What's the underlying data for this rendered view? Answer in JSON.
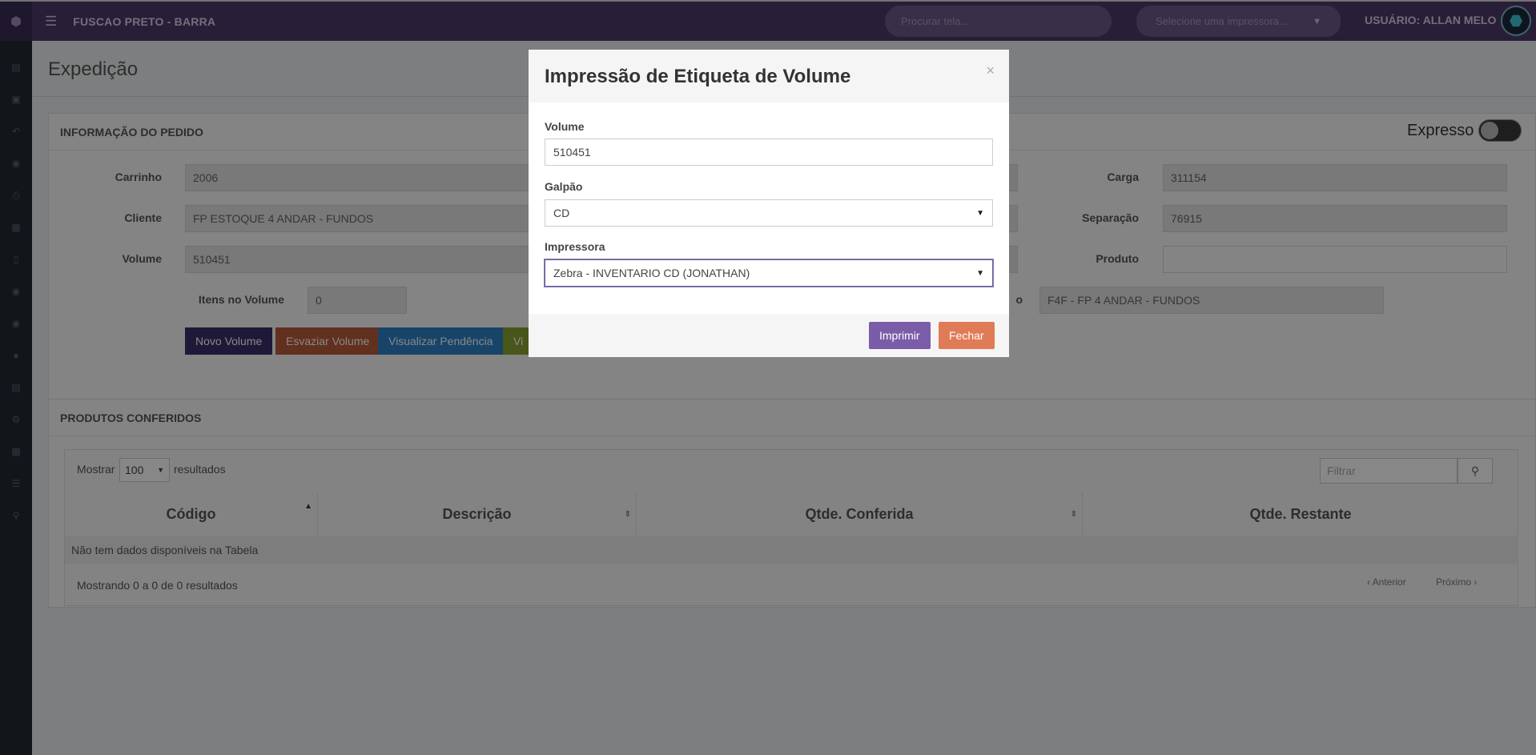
{
  "topbar": {
    "app_title": "FUSCAO PRETO - BARRA",
    "search_placeholder": "Procurar tela...",
    "printer_placeholder": "Selecione uma impressora...",
    "user_label": "USUÁRIO: ALLAN MELO"
  },
  "page": {
    "title": "Expedição"
  },
  "pedido": {
    "header": "INFORMAÇÃO DO PEDIDO",
    "expresso_label": "Expresso",
    "carrinho_label": "Carrinho",
    "carrinho_value": "2006",
    "cliente_label": "Cliente",
    "cliente_value": "FP ESTOQUE 4 ANDAR - FUNDOS",
    "volume_label": "Volume",
    "volume_value": "510451",
    "itens_label": "Itens no Volume",
    "itens_value": "0",
    "carga_label": "Carga",
    "carga_value": "311154",
    "separacao_label": "Separação",
    "separacao_value": "76915",
    "produto_label": "Produto",
    "produto_value": "",
    "partial_label": "o",
    "partial_value": "F4F - FP 4 ANDAR - FUNDOS",
    "btn_novo": "Novo Volume",
    "btn_esvaziar": "Esvaziar Volume",
    "btn_visualizar": "Visualizar Pendência",
    "btn_partial": "Vi"
  },
  "produtos": {
    "header": "PRODUTOS CONFERIDOS",
    "mostrar_label": "Mostrar",
    "mostrar_value": "100",
    "resultados_label": "resultados",
    "filter_placeholder": "Filtrar",
    "columns": [
      "Código",
      "Descrição",
      "Qtde. Conferida",
      "Qtde. Restante"
    ],
    "empty_message": "Não tem dados disponíveis na Tabela",
    "info": "Mostrando 0 a 0 de 0 resultados",
    "prev_label": "Anterior",
    "next_label": "Próximo"
  },
  "modal": {
    "title": "Impressão de Etiqueta de Volume",
    "close": "×",
    "volume_label": "Volume",
    "volume_value": "510451",
    "galpao_label": "Galpão",
    "galpao_value": "CD",
    "impressora_label": "Impressora",
    "impressora_value": "Zebra - INVENTARIO CD (JONATHAN)",
    "btn_imprimir": "Imprimir",
    "btn_fechar": "Fechar"
  },
  "colors": {
    "topbar": "#4d3a6b",
    "sidebar": "#222a33",
    "imprimir": "#7b5ca8",
    "fechar": "#e07b58"
  }
}
